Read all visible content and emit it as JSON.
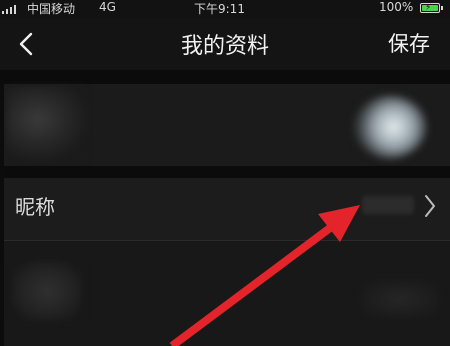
{
  "status_bar": {
    "carrier": "中国移动",
    "network": "4G",
    "time": "下午9:11",
    "battery": "100%"
  },
  "nav": {
    "title": "我的资料",
    "save_label": "保存"
  },
  "rows": {
    "nickname_label": "昵称"
  },
  "colors": {
    "background": "#121212",
    "annotation_arrow": "#e3242b",
    "battery": "#4fd14f"
  },
  "icons": {
    "back": "chevron-left-icon",
    "row_arrow": "chevron-right-icon",
    "signal": "signal-icon",
    "battery": "battery-charging-icon"
  }
}
